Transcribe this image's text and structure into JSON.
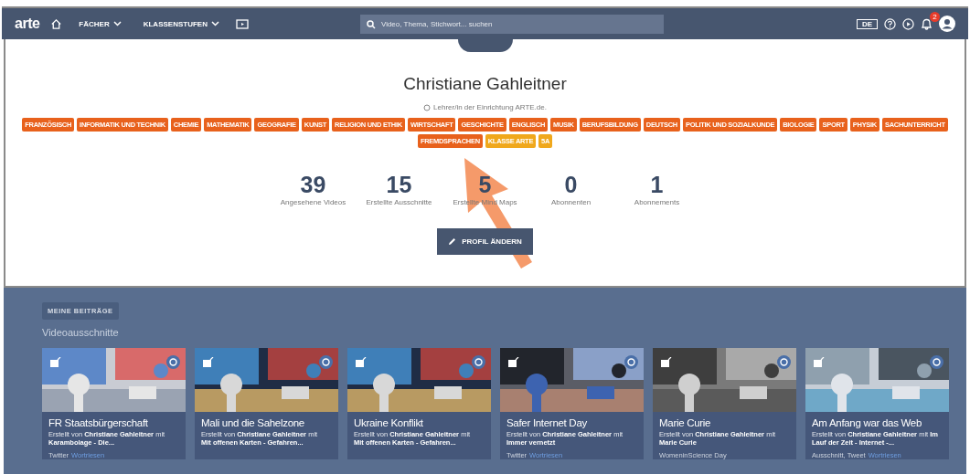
{
  "nav": {
    "logo": "arte",
    "menus": [
      {
        "label": "FÄCHER"
      },
      {
        "label": "KLASSENSTUFEN"
      }
    ],
    "search": {
      "placeholder": "Video, Thema, Stichwort... suchen"
    },
    "lang": "DE",
    "notification_badge": "2"
  },
  "profile": {
    "name": "Christiane Gahleitner",
    "role": "Lehrer/in der Einrichtung ARTE.de.",
    "tags": [
      {
        "label": "FRANZÖSISCH",
        "color": "#e8611c"
      },
      {
        "label": "INFORMATIK UND TECHNIK",
        "color": "#e8611c"
      },
      {
        "label": "CHEMIE",
        "color": "#e8611c"
      },
      {
        "label": "MATHEMATIK",
        "color": "#e8611c"
      },
      {
        "label": "GEOGRAFIE",
        "color": "#e8611c"
      },
      {
        "label": "KUNST",
        "color": "#e8611c"
      },
      {
        "label": "RELIGION UND ETHIK",
        "color": "#e8611c"
      },
      {
        "label": "WIRTSCHAFT",
        "color": "#e8611c"
      },
      {
        "label": "GESCHICHTE",
        "color": "#e8611c"
      },
      {
        "label": "ENGLISCH",
        "color": "#e8611c"
      },
      {
        "label": "MUSIK",
        "color": "#e8611c"
      },
      {
        "label": "BERUFSBILDUNG",
        "color": "#e8611c"
      },
      {
        "label": "DEUTSCH",
        "color": "#e8611c"
      },
      {
        "label": "POLITIK UND SOZIALKUNDE",
        "color": "#e8611c"
      },
      {
        "label": "BIOLOGIE",
        "color": "#e8611c"
      },
      {
        "label": "SPORT",
        "color": "#e8611c"
      },
      {
        "label": "PHYSIK",
        "color": "#e8611c"
      },
      {
        "label": "SACHUNTERRICHT",
        "color": "#e8611c"
      },
      {
        "label": "FREMDSPRACHEN",
        "color": "#e8611c"
      },
      {
        "label": "KLASSE ARTE",
        "color": "#f0a81c"
      },
      {
        "label": "5A",
        "color": "#f0a81c"
      }
    ],
    "stats": [
      {
        "value": "39",
        "label": "Angesehene Videos"
      },
      {
        "value": "15",
        "label": "Erstellte Ausschnitte"
      },
      {
        "value": "5",
        "label": "Erstellte Mind Maps"
      },
      {
        "value": "0",
        "label": "Abonnenten"
      },
      {
        "value": "1",
        "label": "Abonnements"
      }
    ],
    "edit_button": "PROFIL ÄNDERN"
  },
  "contributions": {
    "badge": "MEINE BEITRÄGE",
    "heading": "Videoausschnitte",
    "cards": [
      {
        "title": "FR Staatsbürgerschaft",
        "meta": "Erstellt von **Christiane Gahleitner** mit **Karambolage - Die...**",
        "tags": "Twitter",
        "link": "Wortriesen"
      },
      {
        "title": "Mali und die Sahelzone",
        "meta": "Erstellt von **Christiane Gahleitner** mit",
        "source": "Mit offenen Karten - Gefahren..."
      },
      {
        "title": "Ukraine Konflikt",
        "meta": "Erstellt von **Christiane Gahleitner** mit",
        "source": "Mit offenen Karten - Gefahren..."
      },
      {
        "title": "Safer Internet Day",
        "meta": "Erstellt von **Christiane Gahleitner** mit **Immer vernetzt**",
        "tags": "Twitter",
        "link": "Wortriesen"
      },
      {
        "title": "Marie Curie",
        "meta": "Erstellt von **Christiane Gahleitner** mit **Marie Curie**",
        "tags": "WomeninScience Day"
      },
      {
        "title": "Am Anfang war das Web",
        "meta": "Erstellt von **Christiane Gahleitner** mit **Im Lauf der Zeit - Internet -...**",
        "tags": "Ausschnitt, Tweet",
        "link": "Wortriesen"
      }
    ]
  }
}
